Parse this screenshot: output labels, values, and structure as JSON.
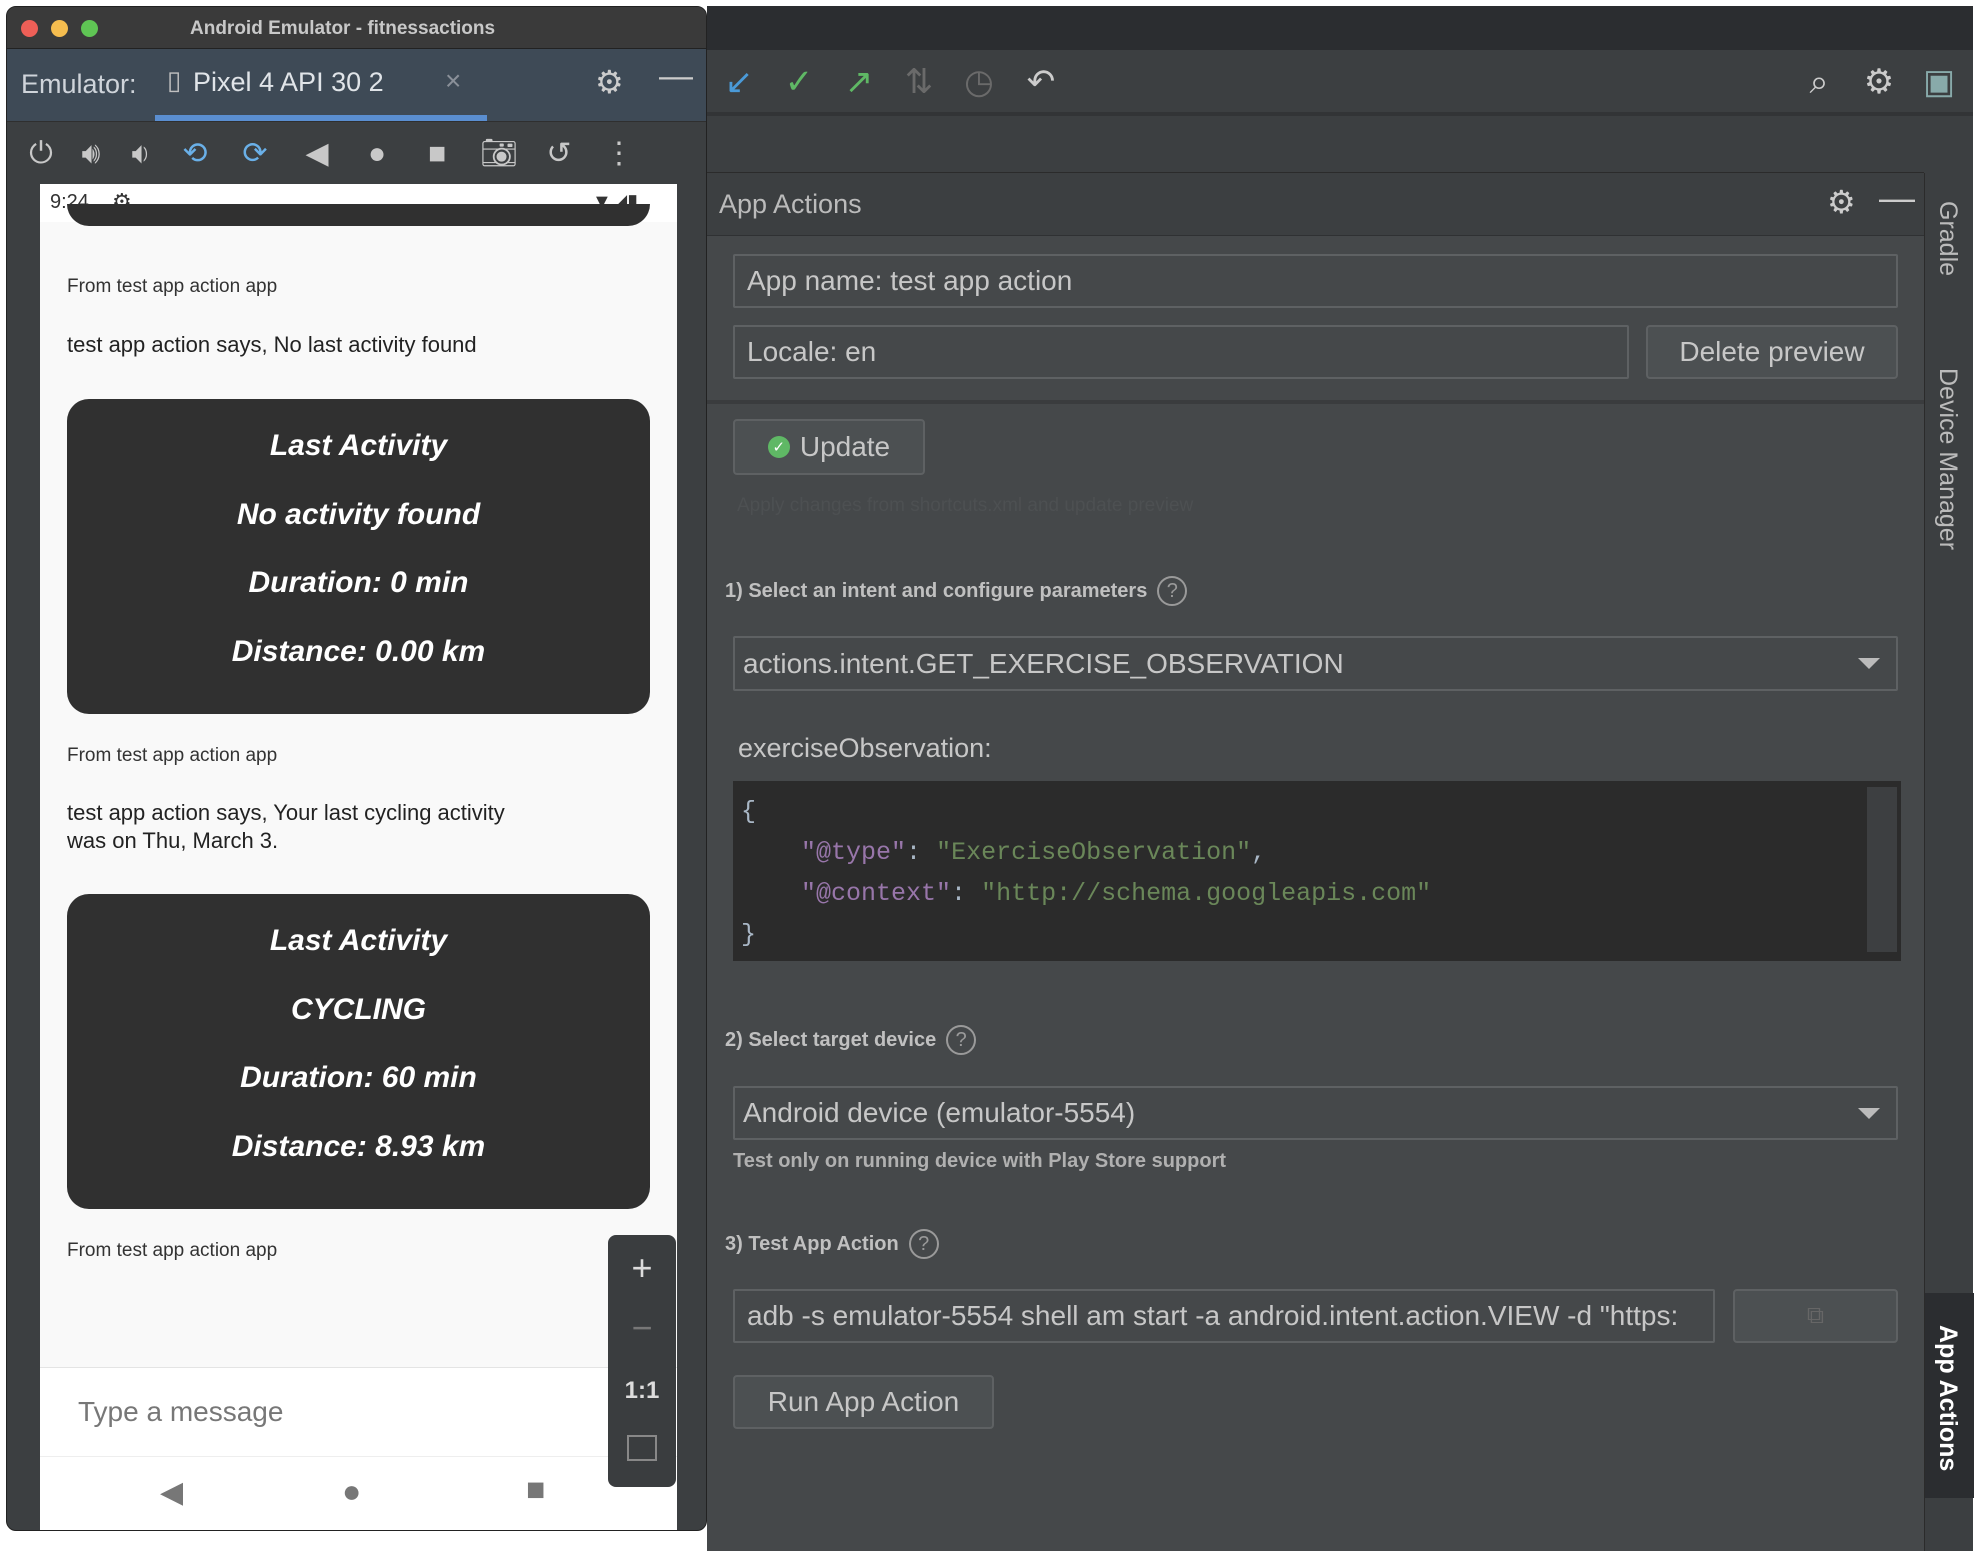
{
  "emulator": {
    "window_title": "Android Emulator - fitnessactions",
    "label": "Emulator:",
    "device_tab": "Pixel 4 API 30 2",
    "close": "×",
    "toolbar_icons": [
      "power-icon",
      "volume-up-icon",
      "volume-down-icon",
      "rotate-left-icon",
      "rotate-right-icon",
      "back-icon",
      "home-icon",
      "overview-icon",
      "camera-icon",
      "snapshot-icon",
      "more-icon"
    ]
  },
  "phone": {
    "time": "9:24",
    "messages": [
      {
        "from": "From test app action app",
        "text": "test app action says, No last activity found",
        "card": [
          "Last Activity",
          "No activity found",
          "Duration: 0 min",
          "Distance: 0.00 km"
        ]
      },
      {
        "from": "From test app action app",
        "text": "test app action says, Your last cycling activity was on Thu, March 3.",
        "card": [
          "Last Activity",
          "CYCLING",
          "Duration: 60 min",
          "Distance: 8.93 km"
        ]
      },
      {
        "from": "From test app action app"
      }
    ],
    "input_placeholder": "Type a message",
    "zoom": {
      "plus": "+",
      "minus": "−",
      "one_to_one": "1:1"
    }
  },
  "panel": {
    "title": "App Actions",
    "app_name": "App name: test app action",
    "locale": "Locale: en",
    "delete_preview": "Delete preview",
    "update": "Update",
    "update_hint": "Apply changes from shortcuts.xml and update preview",
    "step1": "1) Select an intent and configure parameters",
    "intent": "actions.intent.GET_EXERCISE_OBSERVATION",
    "param_label": "exerciseObservation:",
    "code": {
      "open": "{",
      "type_key": "\"@type\"",
      "type_val": "\"ExerciseObservation\"",
      "ctx_key": "\"@context\"",
      "ctx_val": "\"http://schema.googleapis.com\"",
      "close": "}"
    },
    "step2": "2) Select target device",
    "device": "Android device (emulator-5554)",
    "device_hint": "Test only on running device with Play Store support",
    "step3": "3) Test App Action",
    "command": "adb -s emulator-5554 shell am start -a android.intent.action.VIEW -d \"https:",
    "run": "Run App Action"
  },
  "side_tools": {
    "gradle": "Gradle",
    "device_manager": "Device Manager",
    "app_actions": "App Actions"
  },
  "colors": {
    "accent": "#5a8ed0",
    "success": "#5fb865",
    "panel_bg": "#45484a",
    "card_bg": "#303030"
  }
}
